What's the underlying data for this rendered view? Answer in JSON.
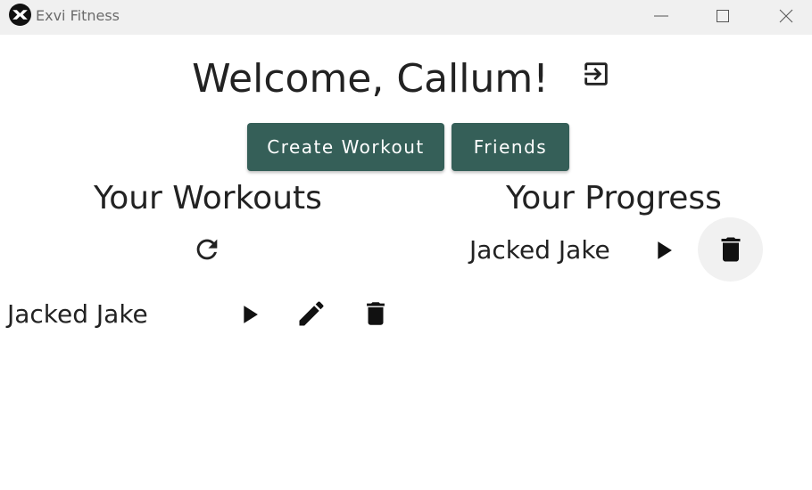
{
  "window": {
    "title": "Exvi Fitness",
    "icon": "exvi-logo-icon"
  },
  "header": {
    "welcome": "Welcome, Callum!",
    "logout_icon": "logout-icon"
  },
  "actions": {
    "create_workout_label": "Create Workout",
    "friends_label": "Friends"
  },
  "workouts": {
    "title": "Your Workouts",
    "refresh_icon": "refresh-icon",
    "items": [
      {
        "name": "Jacked Jake",
        "icons": [
          "play-icon",
          "edit-icon",
          "delete-icon"
        ]
      }
    ]
  },
  "progress": {
    "title": "Your Progress",
    "items": [
      {
        "name": "Jacked Jake",
        "icons": [
          "play-icon",
          "delete-icon"
        ]
      }
    ]
  },
  "colors": {
    "accent": "#355f58",
    "titlebar": "#f0f0f0",
    "text": "#222222",
    "hover_circle": "#f1f1f1"
  }
}
